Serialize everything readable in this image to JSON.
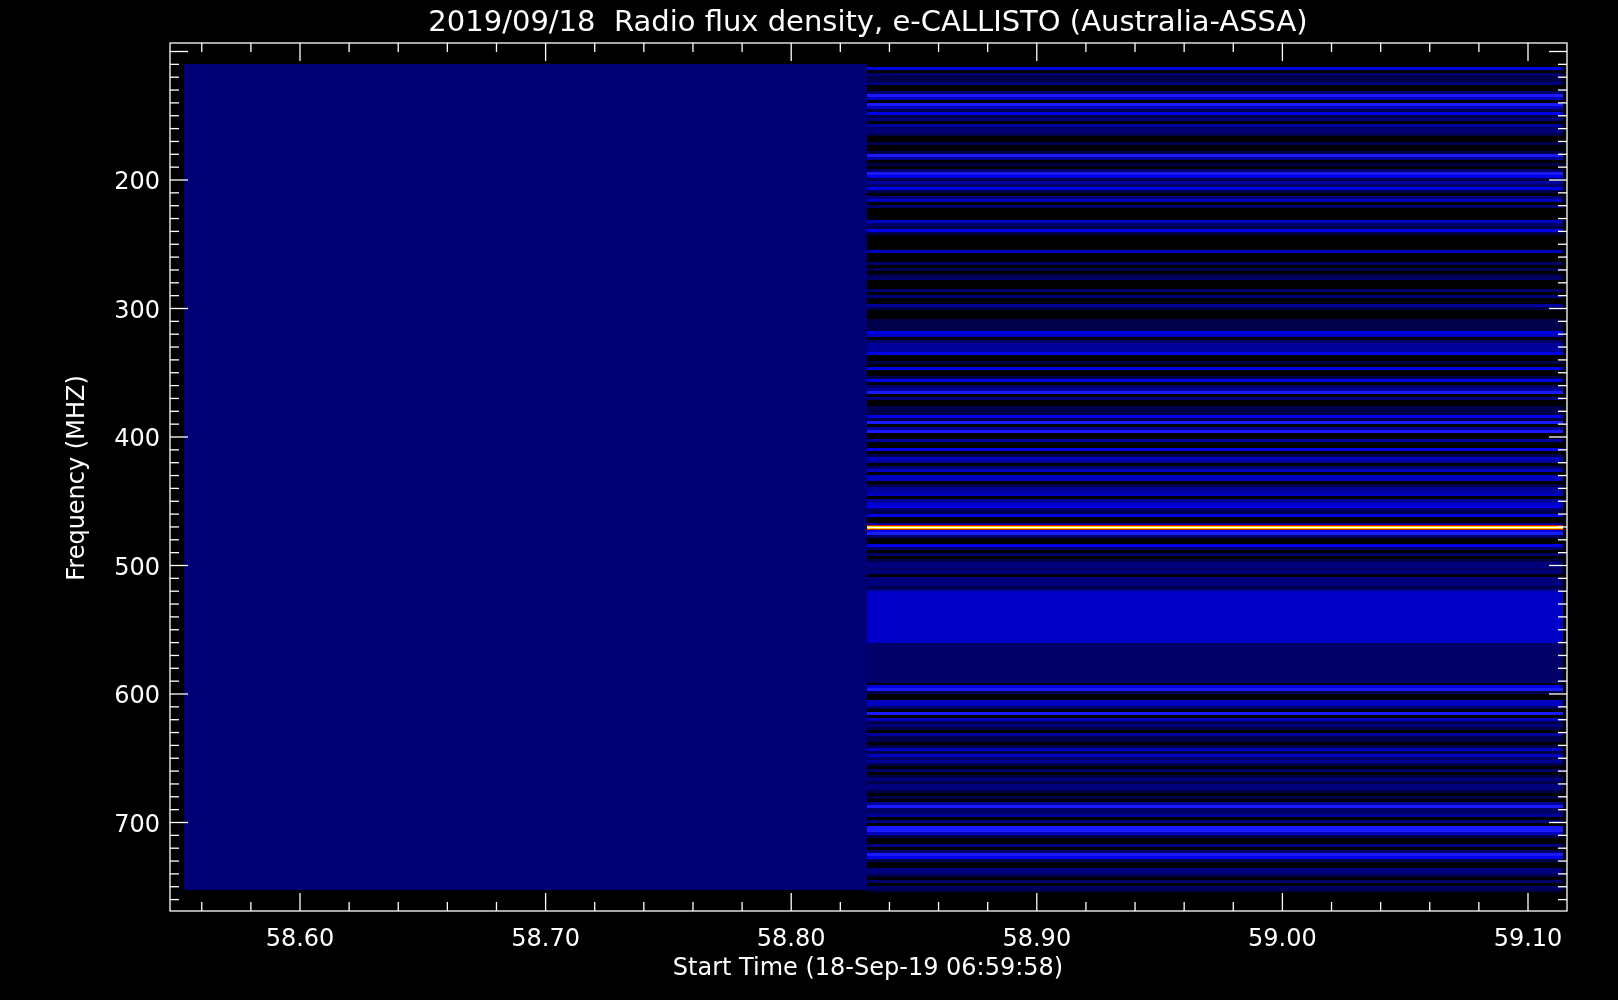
{
  "title": "2019/09/18  Radio flux density, e-CALLISTO (Australia-ASSA)",
  "plot": {
    "xlabel": "Start Time (18-Sep-19 06:59:58)",
    "ylabel": "Frequency (MHZ)",
    "xticks": [
      "58.60",
      "58.70",
      "58.80",
      "58.90",
      "59.00",
      "59.10"
    ],
    "yticks": [
      "200",
      "300",
      "400",
      "500",
      "600",
      "700"
    ]
  }
}
